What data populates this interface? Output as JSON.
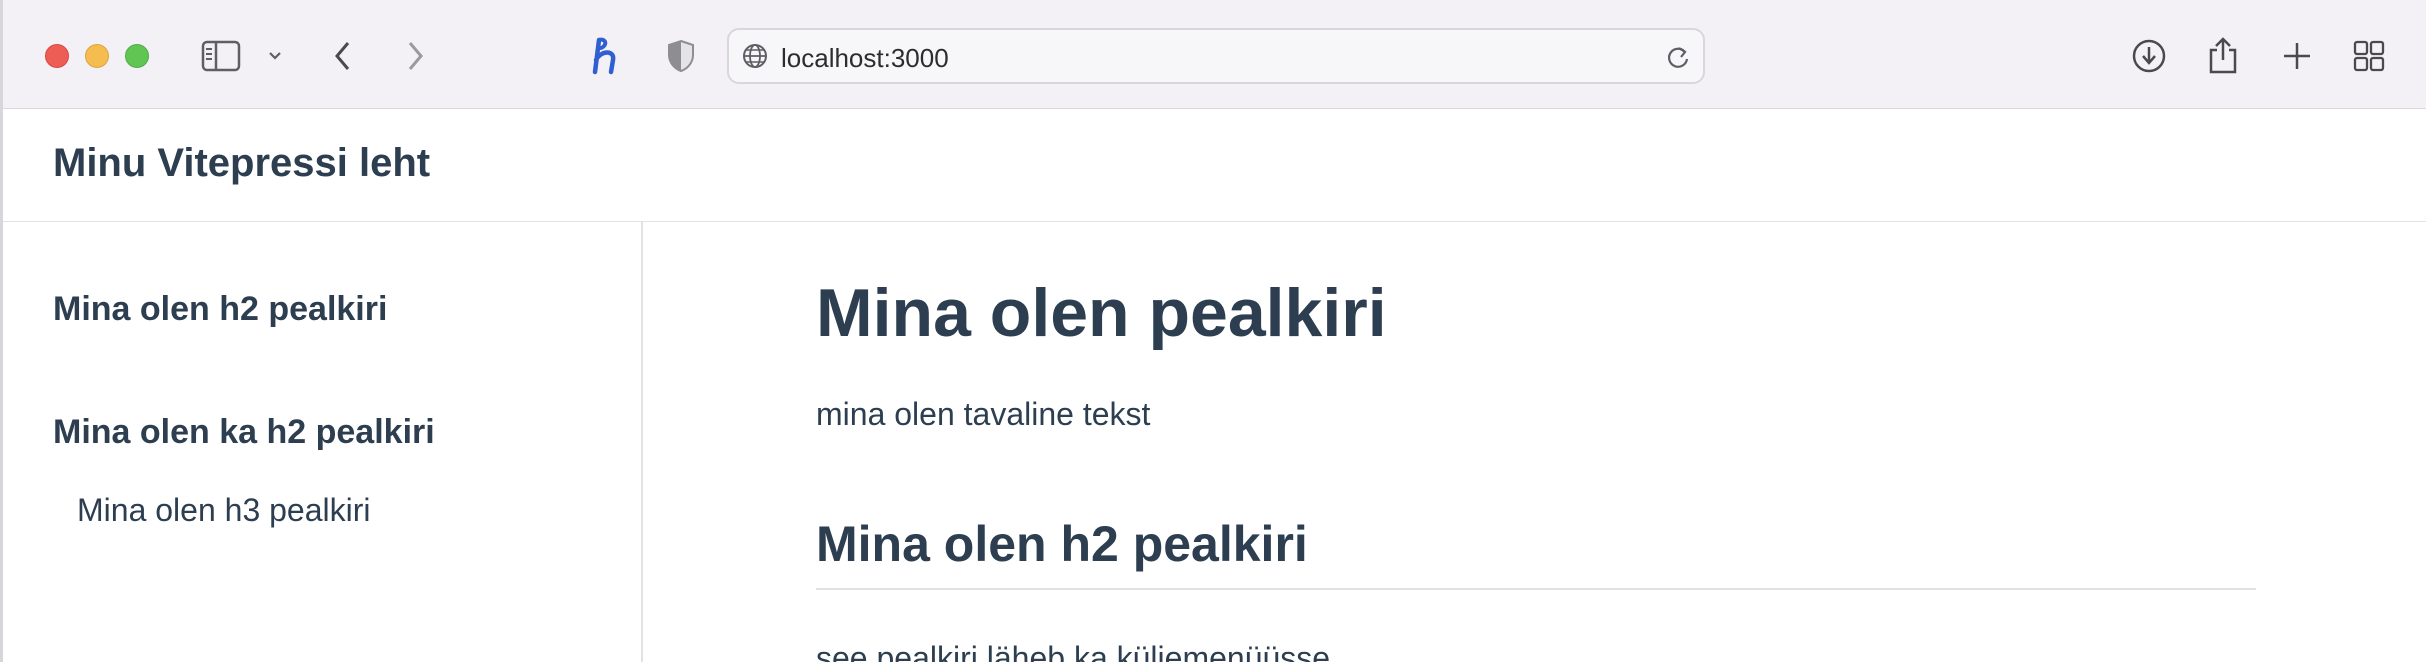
{
  "browser": {
    "url": "localhost:3000",
    "icons": [
      "sidebar-icon",
      "chevron-down-icon",
      "back-icon",
      "forward-icon",
      "honey-extension-icon",
      "privacy-shield-icon",
      "globe-icon",
      "reload-icon",
      "download-icon",
      "share-icon",
      "new-tab-icon",
      "tab-overview-icon"
    ]
  },
  "site": {
    "title": "Minu Vitepressi leht"
  },
  "sidebar": {
    "items": [
      {
        "label": "Mina olen h2 pealkiri",
        "level": "h2"
      },
      {
        "label": "Mina olen ka h2 pealkiri",
        "level": "h2"
      },
      {
        "label": "Mina olen h3 pealkiri",
        "level": "h3"
      }
    ]
  },
  "content": {
    "h1": "Mina olen pealkiri",
    "p1": "mina olen tavaline tekst",
    "h2": "Mina olen h2 pealkiri",
    "p2": "see pealkiri läheb ka küljemenüüsse"
  },
  "colors": {
    "text": "#2c3e50",
    "toolbar": "#f3f1f6",
    "divider": "#e2e2e3",
    "honey_blue": "#2f5fd0"
  }
}
